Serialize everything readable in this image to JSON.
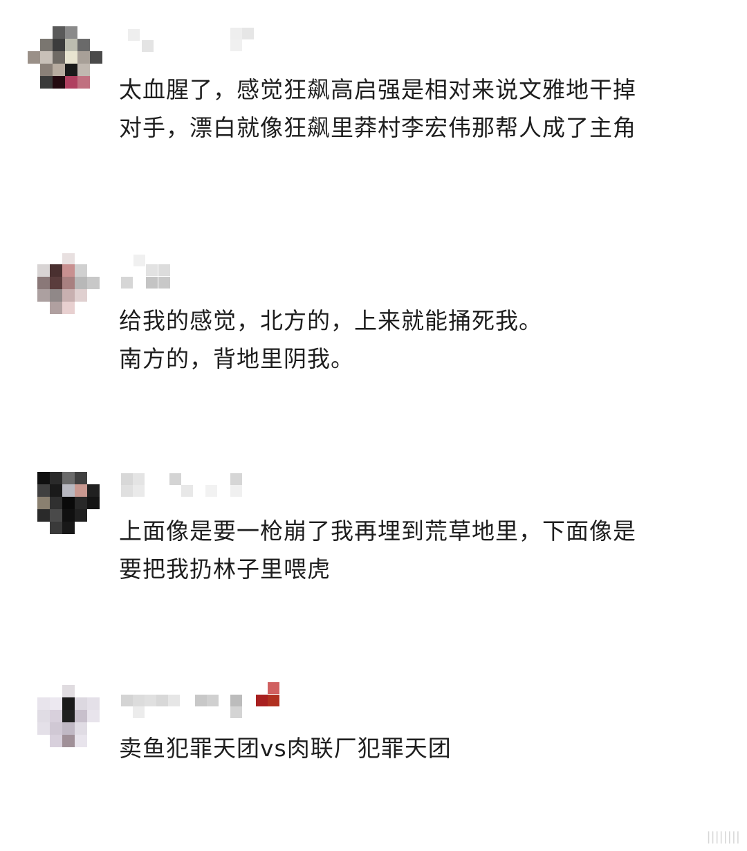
{
  "comments": [
    {
      "text": "太血腥了，感觉狂飙高启强是相对来说文雅地干掉对手，漂白就像狂飙里莽村李宏伟那帮人成了主角"
    },
    {
      "text": "给我的感觉，北方的，上来就能捅死我。\n南方的，背地里阴我。"
    },
    {
      "text": "上面像是要一枪崩了我再埋到荒草地里，下面像是要把我扔林子里喂虎"
    },
    {
      "text": "卖鱼犯罪天团vs肉联厂犯罪天团"
    }
  ],
  "watermark": "||||||||"
}
